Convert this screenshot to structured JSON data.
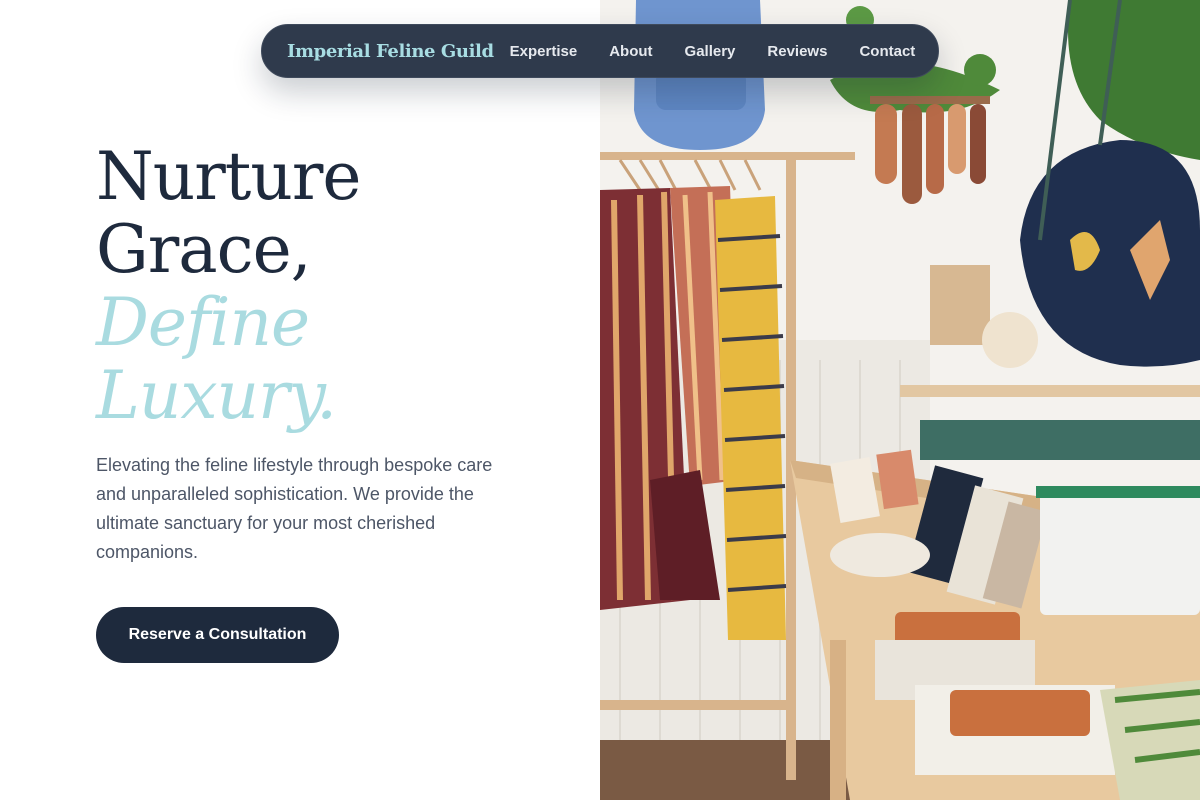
{
  "nav": {
    "brand": "Imperial Feline Guild",
    "links": [
      "Expertise",
      "About",
      "Gallery",
      "Reviews",
      "Contact"
    ]
  },
  "hero": {
    "title_lines": [
      "Nurture",
      "Grace,",
      "Define",
      "Luxury."
    ],
    "description": "Elevating the feline lifestyle through bespoke care and unparalleled sophistication. We provide the ultimate sanctuary for your most cherished companions.",
    "cta_label": "Reserve a Consultation"
  },
  "colors": {
    "navy": "#1e2a3d",
    "nav_background": "#2f3a4c",
    "accent_teal": "#a9dbe0",
    "body_text": "#4d5667"
  }
}
